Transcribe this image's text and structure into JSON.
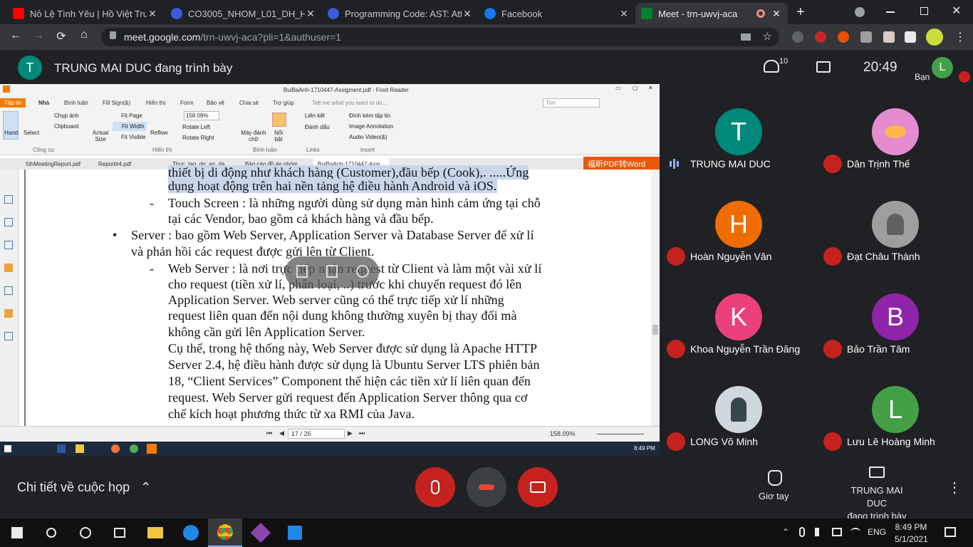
{
  "browser": {
    "tabs": [
      {
        "title": "Nỏ Lệ Tình Yêu | Hồ Việt Trung",
        "color": "#ff0000"
      },
      {
        "title": "CO3005_NHOM_L01_DH_HK2",
        "color": "#3b5bdb"
      },
      {
        "title": "Programming Code: AST: Atte",
        "color": "#3b5bdb"
      },
      {
        "title": "Facebook",
        "color": "#1877f2"
      },
      {
        "title": "Meet - trn-uwvj-aca",
        "color": "#00832d"
      }
    ],
    "close_glyph": "✕",
    "new_tab_glyph": "+",
    "url_domain": "meet.google.com",
    "url_path": "/trn-uwvj-aca?pli=1&authuser=1"
  },
  "meet": {
    "presenter_initial": "T",
    "presenting_title": "TRUNG MAI DUC đang trình bày",
    "participant_count": "10",
    "clock": "20:49",
    "self_label": "Bạn",
    "self_initial": "L",
    "participants": [
      {
        "name": "TRUNG MAI DUC",
        "initial": "T",
        "color": "#00897b",
        "muted": false
      },
      {
        "name": "Dân Trịnh Thế",
        "initial": "",
        "color": "#e58bd0",
        "muted": true
      },
      {
        "name": "Hoàn Nguyễn Văn",
        "initial": "H",
        "color": "#ef6c00",
        "muted": true
      },
      {
        "name": "Đạt Châu Thành",
        "initial": "",
        "color": "#9e9e9e",
        "muted": true
      },
      {
        "name": "Khoa Nguyễn Trần Đăng",
        "initial": "K",
        "color": "#ec407a",
        "muted": true
      },
      {
        "name": "Bảo Trần Tâm",
        "initial": "B",
        "color": "#8e24aa",
        "muted": true
      },
      {
        "name": "LONG Võ Minh",
        "initial": "",
        "color": "#cfd8dc",
        "muted": true
      },
      {
        "name": "Lưu Lê Hoàng Minh",
        "initial": "L",
        "color": "#43a047",
        "muted": true
      }
    ],
    "meeting_details": "Chi tiết về cuộc họp",
    "raise_hand": "Giơ tay",
    "presenting_line1": "TRUNG MAI DUC",
    "presenting_line2": "đang trình bày"
  },
  "foxit": {
    "window_title": "BuiBaAnh-1710447-Assigment.pdf - Foxit Reader",
    "menus": [
      "Tập tin",
      "Nhà",
      "Bình luận",
      "Fill Sign(&)",
      "Hiển thị",
      "Form",
      "Bảo vệ",
      "Chia sẻ",
      "Trợ giúp",
      "Tell me what you want to do..."
    ],
    "search_placeholder": "Tìm",
    "ribbon": {
      "hand": "Hand",
      "select": "Select",
      "chup_anh": "Chụp ảnh",
      "clipboard": "Clipboard",
      "cong_cu": "Công cụ",
      "actual_size": "Actual Size",
      "fit_page": "Fit Page",
      "fit_width": "Fit Width",
      "fit_visible": "Fit Visible",
      "reflow": "Reflow",
      "zoom": "158.09%",
      "rotate_left": "Rotate Left",
      "rotate_right": "Rotate Right",
      "hien_thi": "Hiển thị",
      "may_danh_chu": "Máy đánh chữ",
      "noi_bat": "Nổi bật",
      "binh_luan": "Bình luận",
      "lien_ket": "Liên kết",
      "danh_dau": "Đánh dấu",
      "links": "Links",
      "dinh_kem": "Đính kèm tập tin",
      "image_annotation": "Image Annotation",
      "audio_video": "Audio  Video(&)",
      "insert": "Insert"
    },
    "doc_tabs": [
      "5thMeetingReport.pdf",
      "Report#4.pdf",
      "Thuc_tap_do_an_da_...",
      "Báo cáo đồ án nhóm ...",
      "BuiBaAnh-1710447-Assi..."
    ],
    "promo": "福昕PDF转Word",
    "page_lines": [
      "thiết bị di động như khách hàng (Customer),đầu bếp (Cook),. .....Ứng",
      "dụng hoạt động trên hai nền tảng hệ điều hành Android và iOS.",
      "Touch Screen : là những người dùng sử dụng màn hình cảm ứng tại chỗ",
      "tại các Vendor, bao gồm cả khách hàng và đầu bếp.",
      "Server : bao gồm Web Server, Application Server và Database Server để xử lí",
      "và phản hồi các request được gửi lên từ Client.",
      "Web Server : là nơi trực tiếp nhận request từ Client và làm một vài xử lí",
      "cho request (tiền xử lí, phân loại, ..) trước khi chuyển request đó lên",
      "Application Server. Web server cũng có thể trực tiếp xử lí những",
      "request liên quan đến nội dung không thường xuyên bị thay đổi mà",
      "không cần gửi lên Application Server.",
      "Cụ thể, trong hệ thống này, Web Server được sử dụng là Apache HTTP",
      "Server 2.4, hệ điều hành được sử dụng là Ubuntu Server LTS phiên bản",
      "18, “Client Services” Component thể hiện các tiền xử lí liên quan đến",
      "request. Web Server gửi request đến Application Server thông qua cơ",
      "chế kích hoạt phương thức từ xa RMI của Java."
    ],
    "list_markers": [
      "-",
      "•",
      "-"
    ],
    "page_nav": "17 / 26",
    "status_zoom": "158.09%",
    "inner_clock": "8:49 PM"
  },
  "taskbar": {
    "time": "8:49 PM",
    "date": "5/1/2021",
    "lang": "ENG"
  }
}
